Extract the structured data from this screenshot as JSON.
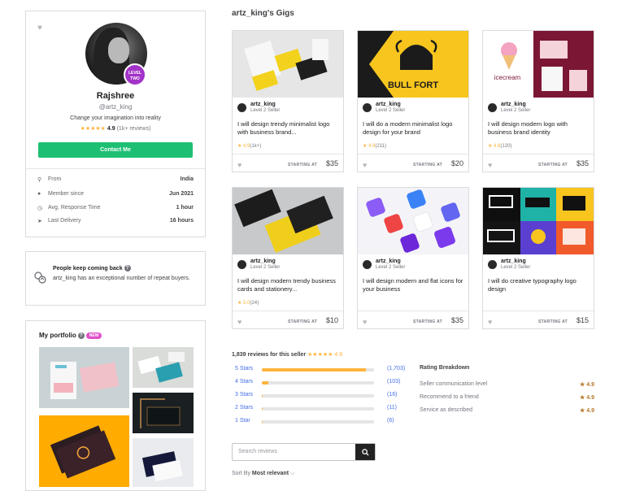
{
  "profile": {
    "name": "Rajshree",
    "handle": "@artz_king",
    "level_badge_line1": "LEVEL",
    "level_badge_line2": "TWO",
    "tagline": "Change your imagination into reality",
    "stars": "★★★★★",
    "rating": "4.9",
    "reviews": "(1k+ reviews)",
    "contact_label": "Contact Me",
    "stats": [
      {
        "label": "From",
        "value": "India",
        "icon": "location-icon"
      },
      {
        "label": "Member since",
        "value": "Jun 2021",
        "icon": "user-icon"
      },
      {
        "label": "Avg. Response Time",
        "value": "1 hour",
        "icon": "clock-icon"
      },
      {
        "label": "Last Delivery",
        "value": "16 hours",
        "icon": "paper-plane-icon"
      }
    ]
  },
  "repeat_buyers": {
    "title": "People keep coming back",
    "text": "artz_king has an exceptional number of repeat buyers."
  },
  "portfolio": {
    "title": "My portfolio",
    "badge": "NEW"
  },
  "gigs_section": {
    "title": "artz_king's Gigs",
    "gigs": [
      {
        "seller": "artz_king",
        "level": "Level 2 Seller",
        "title": "I will design trendy minimalist logo with business brand...",
        "rating": "4.9",
        "count": "(1k+)",
        "starting_at": "STARTING AT",
        "price": "$35"
      },
      {
        "seller": "artz_king",
        "level": "Level 2 Seller",
        "title": "I will do a modern minimalist logo design for your brand",
        "rating": "4.9",
        "count": "(211)",
        "starting_at": "STARTING AT",
        "price": "$20",
        "image_text": "BULL FORT"
      },
      {
        "seller": "artz_king",
        "level": "Level 2 Seller",
        "title": "I will design modern logo with business brand identity",
        "rating": "4.8",
        "count": "(120)",
        "starting_at": "STARTING AT",
        "price": "$35",
        "image_text": "icecream"
      },
      {
        "seller": "artz_king",
        "level": "Level 2 Seller",
        "title": "I will design modern trendy business cards and stationery...",
        "rating": "5.0",
        "count": "(24)",
        "starting_at": "STARTING AT",
        "price": "$10"
      },
      {
        "seller": "artz_king",
        "level": "Level 2 Seller",
        "title": "I will design modern and flat icons for your business",
        "rating": "",
        "count": "",
        "starting_at": "STARTING AT",
        "price": "$35"
      },
      {
        "seller": "artz_king",
        "level": "Level 2 Seller",
        "title": "I will do creative typography logo design",
        "rating": "",
        "count": "",
        "starting_at": "STARTING AT",
        "price": "$15"
      }
    ]
  },
  "reviews": {
    "count_text": "1,839 reviews for this seller",
    "stars": "★★★★★",
    "rating": "4.9",
    "bars": [
      {
        "label": "5 Stars",
        "count": "(1,703)",
        "fraction": 0.926
      },
      {
        "label": "4 Stars",
        "count": "(103)",
        "fraction": 0.056
      },
      {
        "label": "3 Stars",
        "count": "(16)",
        "fraction": 0.009
      },
      {
        "label": "2 Stars",
        "count": "(11)",
        "fraction": 0.006
      },
      {
        "label": "1 Star",
        "count": "(6)",
        "fraction": 0.003
      }
    ],
    "breakdown_title": "Rating Breakdown",
    "breakdown": [
      {
        "label": "Seller communication level",
        "value": "4.9"
      },
      {
        "label": "Recommend to a friend",
        "value": "4.9"
      },
      {
        "label": "Service as described",
        "value": "4.9"
      }
    ],
    "search_placeholder": "Search reviews",
    "sort_label": "Sort By",
    "sort_value": "Most relevant"
  },
  "colors": {
    "accent": "#1dbf73",
    "star": "#ffb33e",
    "link": "#446ee7",
    "level_badge": "#a333c8"
  }
}
